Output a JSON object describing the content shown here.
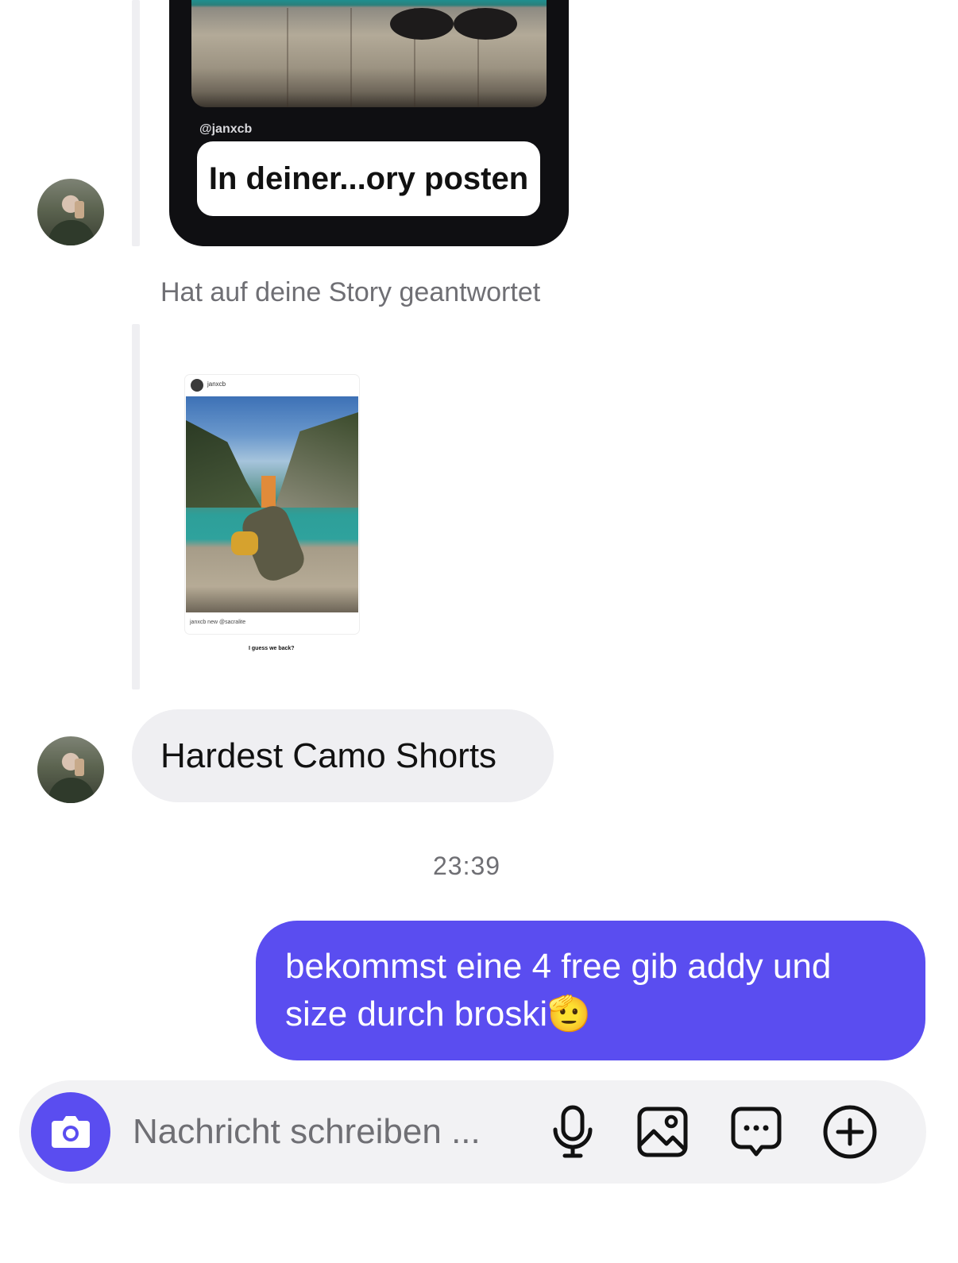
{
  "thread": {
    "story_share": {
      "handle": "@janxcb",
      "button_label": "In deiner...ory posten"
    },
    "reply_caption": "Hat auf deine Story geantwortet",
    "shared_post": {
      "username": "janxcb",
      "footer": "janxcb new @sacralite",
      "text": "I guess we back?"
    },
    "incoming_message": "Hardest Camo Shorts",
    "timestamp": "23:39",
    "outgoing_message": "bekommst eine 4 free gib addy und size durch broski🫡"
  },
  "composer": {
    "placeholder": "Nachricht schreiben ...",
    "icons": [
      "camera-icon",
      "microphone-icon",
      "image-icon",
      "sticker-icon",
      "plus-icon"
    ]
  },
  "colors": {
    "accent": "#5a4df0",
    "incoming_bubble": "#efeff2",
    "secondary_text": "#6f6f74"
  }
}
